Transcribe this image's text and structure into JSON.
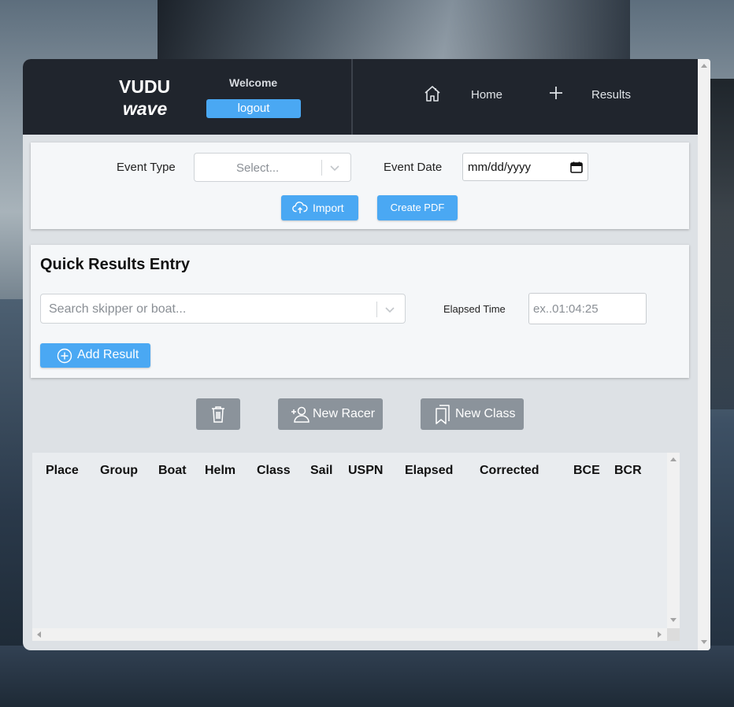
{
  "header": {
    "logo_line1": "VUDU",
    "logo_line2": "wave",
    "welcome": "Welcome",
    "logout_label": "logout",
    "nav": {
      "home_label": "Home",
      "results_label": "Results"
    }
  },
  "event_form": {
    "event_type_label": "Event Type",
    "event_type_placeholder": "Select...",
    "event_date_label": "Event Date",
    "event_date_value": "mm/dd/yyyy",
    "import_label": "Import",
    "create_pdf_label": "Create PDF"
  },
  "quick_entry": {
    "title": "Quick Results Entry",
    "search_placeholder": "Search skipper or boat...",
    "elapsed_label": "Elapsed Time",
    "elapsed_placeholder": "ex..01:04:25",
    "add_result_label": "Add Result"
  },
  "actions": {
    "new_racer_label": "New Racer",
    "new_class_label": "New Class"
  },
  "results_table": {
    "columns": [
      "Place",
      "Group",
      "Boat",
      "Helm",
      "Class",
      "Sail",
      "USPN",
      "Elapsed",
      "Corrected",
      "BCE",
      "BCR"
    ],
    "rows": []
  },
  "colors": {
    "header_bg": "#20252d",
    "accent_blue": "#4aa8f3",
    "secondary_gray": "#8b939b",
    "panel_bg": "#dde1e5"
  },
  "icons": [
    "home-icon",
    "plus-icon",
    "chevron-down-icon",
    "calendar-icon",
    "cloud-upload-icon",
    "add-circle-icon",
    "trash-icon",
    "add-user-icon",
    "bookmark-icon"
  ]
}
